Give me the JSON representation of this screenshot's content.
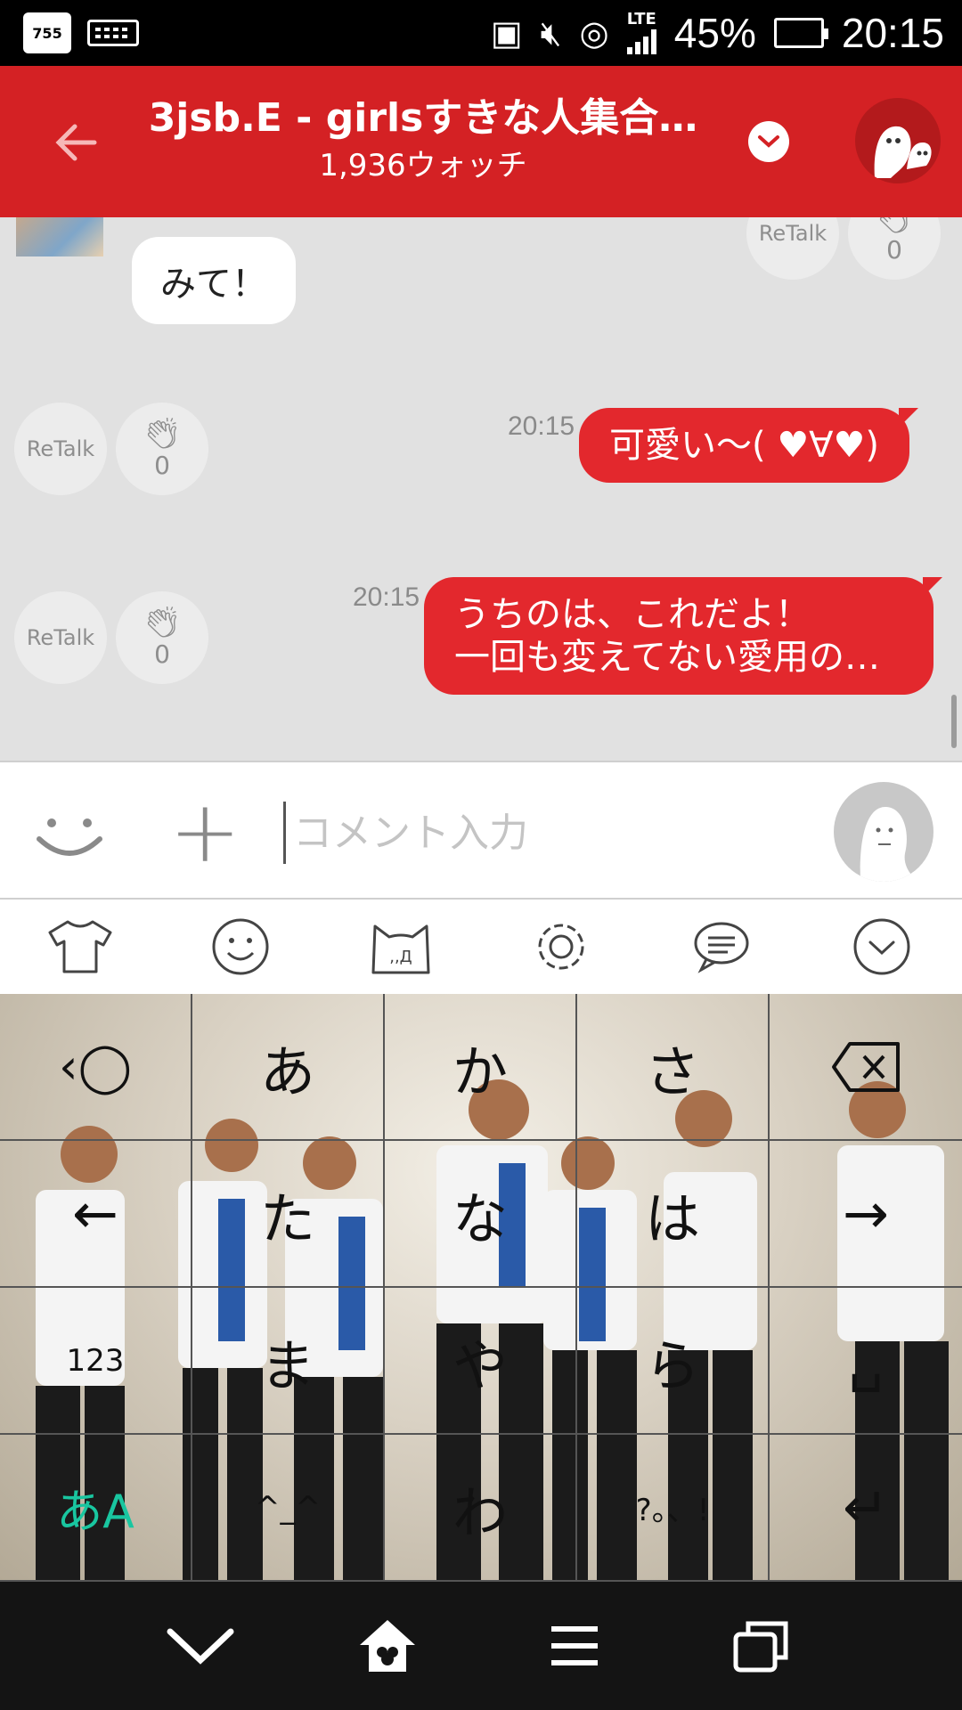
{
  "status_bar": {
    "app_badge": "755",
    "signal_label": "LTE",
    "battery": "45%",
    "time": "20:15"
  },
  "header": {
    "title": "3jsb.E - girlsすきな人集合…",
    "subtitle": "1,936ウォッチ"
  },
  "messages": [
    {
      "type": "incoming",
      "text": "みて！"
    },
    {
      "type": "outgoing",
      "time": "20:15",
      "text": "可愛い〜( ♥∀♥)",
      "retalk": "ReTalk",
      "claps": "0"
    },
    {
      "type": "outgoing",
      "time": "20:15",
      "line1": "うちのは、これだよ！",
      "line2": "一回も変えてない愛用の…",
      "retalk": "ReTalk",
      "claps": "0"
    }
  ],
  "top_actions": {
    "retalk": "ReTalk",
    "claps": "0"
  },
  "comment": {
    "placeholder": "コメント入力",
    "value": ""
  },
  "keyboard": {
    "rows": [
      [
        "",
        "あ",
        "か",
        "さ",
        ""
      ],
      [
        "",
        "た",
        "な",
        "は",
        ""
      ],
      [
        "123",
        "ま",
        "や",
        "ら",
        ""
      ],
      [
        "あA",
        "^_^",
        "わ",
        "?。、!",
        ""
      ]
    ]
  }
}
